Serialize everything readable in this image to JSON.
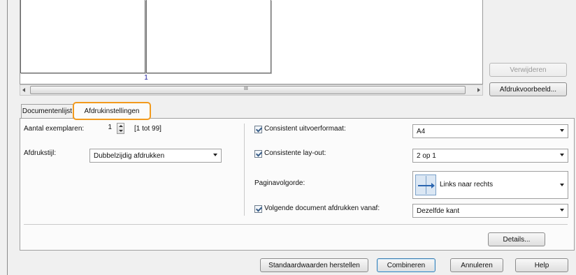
{
  "preview": {
    "page_number": "1",
    "scroll_mid_glyph": "III"
  },
  "buttons": {
    "remove": "Verwijderen",
    "print_preview": "Afdrukvoorbeeld...",
    "details": "Details...",
    "restore_defaults": "Standaardwaarden herstellen",
    "combine": "Combineren",
    "cancel": "Annuleren",
    "help": "Help"
  },
  "tabs": [
    {
      "label": "Documentenlijst"
    },
    {
      "label": "Afdrukinstellingen"
    }
  ],
  "settings": {
    "copies_label": "Aantal exemplaren:",
    "copies_value": "1",
    "copies_range": "[1 tot 99]",
    "print_style_label": "Afdrukstijl:",
    "print_style_value": "Dubbelzijdig afdrukken",
    "consistent_output_label": "Consistent uitvoerformaat:",
    "consistent_output_value": "A4",
    "consistent_layout_label": "Consistente lay-out:",
    "consistent_layout_value": "2 op 1",
    "page_order_label": "Paginavolgorde:",
    "page_order_value": "Links naar rechts",
    "next_doc_label": "Volgende document afdrukken vanaf:",
    "next_doc_value": "Dezelfde kant"
  },
  "colors": {
    "accent_highlight": "#f29a1d",
    "window_bg": "#f0f0f0",
    "default_button_border": "#3c7fb1"
  }
}
